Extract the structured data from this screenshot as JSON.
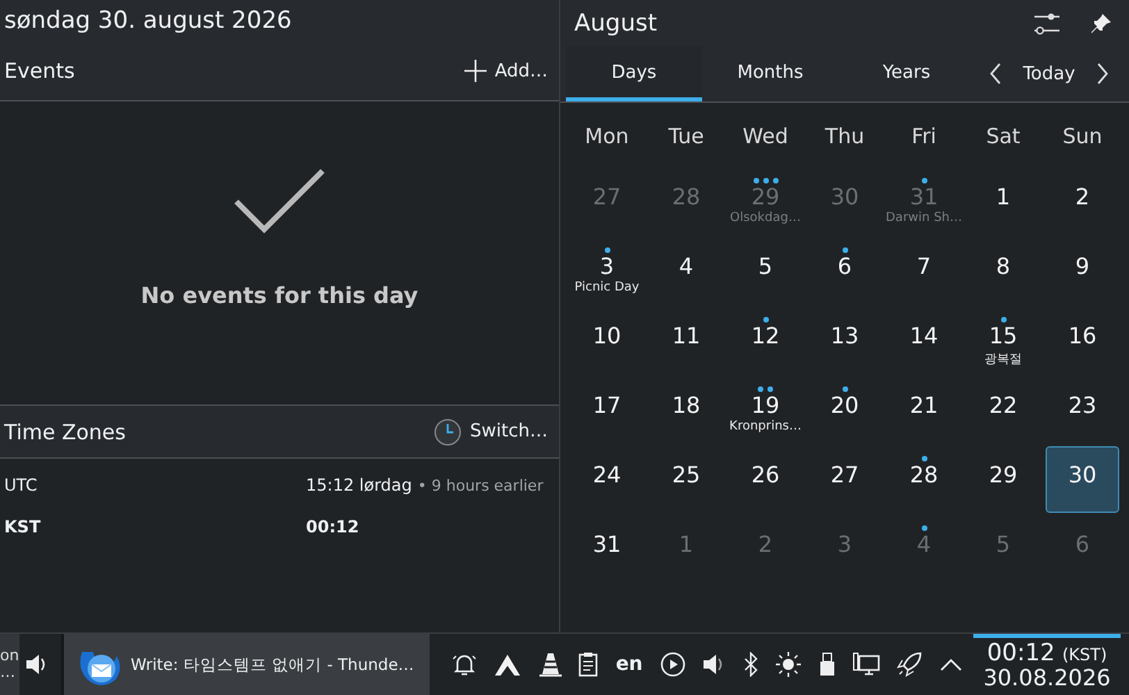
{
  "header": {
    "date": "søndag 30. august 2026"
  },
  "events": {
    "title": "Events",
    "add_label": "Add…",
    "empty_message": "No events for this day"
  },
  "time_zones": {
    "title": "Time Zones",
    "switch_label": "Switch…",
    "rows": [
      {
        "zone": "UTC",
        "time": "15:12 lørdag",
        "note": "• 9 hours earlier",
        "current": false
      },
      {
        "zone": "KST",
        "time": "00:12",
        "current": true
      }
    ]
  },
  "calendar": {
    "month": "August",
    "tabs": [
      {
        "label": "Days",
        "selected": true
      },
      {
        "label": "Months",
        "selected": false
      },
      {
        "label": "Years",
        "selected": false
      }
    ],
    "today_label": "Today",
    "weekdays": [
      "Mon",
      "Tue",
      "Wed",
      "Thu",
      "Fri",
      "Sat",
      "Sun"
    ],
    "days": [
      {
        "day": "27",
        "outside": true,
        "selected": false
      },
      {
        "day": "28",
        "outside": true,
        "selected": false
      },
      {
        "day": "29",
        "outside": true,
        "event_dots": [
          {
            "kind": "event"
          },
          {
            "kind": "event"
          },
          {
            "kind": "event"
          }
        ],
        "label": "Olsokdag…",
        "selected": false
      },
      {
        "day": "30",
        "outside": true,
        "selected": false
      },
      {
        "day": "31",
        "outside": true,
        "event_dots": [
          {
            "kind": "event"
          }
        ],
        "label": "Darwin Sh…",
        "selected": false
      },
      {
        "day": "1",
        "outside": false,
        "selected": false
      },
      {
        "day": "2",
        "outside": false,
        "selected": false
      },
      {
        "day": "3",
        "outside": false,
        "event_dots": [
          {
            "kind": "event"
          }
        ],
        "label": "Picnic Day",
        "selected": false
      },
      {
        "day": "4",
        "outside": false,
        "selected": false
      },
      {
        "day": "5",
        "outside": false,
        "selected": false
      },
      {
        "day": "6",
        "outside": false,
        "event_dots": [
          {
            "kind": "event"
          }
        ],
        "selected": false
      },
      {
        "day": "7",
        "outside": false,
        "selected": false
      },
      {
        "day": "8",
        "outside": false,
        "selected": false
      },
      {
        "day": "9",
        "outside": false,
        "selected": false
      },
      {
        "day": "10",
        "outside": false,
        "selected": false
      },
      {
        "day": "11",
        "outside": false,
        "selected": false
      },
      {
        "day": "12",
        "outside": false,
        "event_dots": [
          {
            "kind": "event"
          }
        ],
        "selected": false
      },
      {
        "day": "13",
        "outside": false,
        "selected": false
      },
      {
        "day": "14",
        "outside": false,
        "selected": false
      },
      {
        "day": "15",
        "outside": false,
        "event_dots": [
          {
            "kind": "event"
          }
        ],
        "label": "광복절",
        "selected": false
      },
      {
        "day": "16",
        "outside": false,
        "selected": false
      },
      {
        "day": "17",
        "outside": false,
        "selected": false
      },
      {
        "day": "18",
        "outside": false,
        "selected": false
      },
      {
        "day": "19",
        "outside": false,
        "event_dots": [
          {
            "kind": "event"
          },
          {
            "kind": "event"
          }
        ],
        "label": "Kronprins…",
        "selected": false
      },
      {
        "day": "20",
        "outside": false,
        "event_dots": [
          {
            "kind": "event"
          }
        ],
        "selected": false
      },
      {
        "day": "21",
        "outside": false,
        "selected": false
      },
      {
        "day": "22",
        "outside": false,
        "selected": false
      },
      {
        "day": "23",
        "outside": false,
        "selected": false
      },
      {
        "day": "24",
        "outside": false,
        "selected": false
      },
      {
        "day": "25",
        "outside": false,
        "selected": false
      },
      {
        "day": "26",
        "outside": false,
        "selected": false
      },
      {
        "day": "27",
        "outside": false,
        "selected": false
      },
      {
        "day": "28",
        "outside": false,
        "event_dots": [
          {
            "kind": "event"
          }
        ],
        "selected": false
      },
      {
        "day": "29",
        "outside": false,
        "selected": false
      },
      {
        "day": "30",
        "outside": false,
        "selected": true
      },
      {
        "day": "31",
        "outside": false,
        "selected": false
      },
      {
        "day": "1",
        "outside": true,
        "selected": false
      },
      {
        "day": "2",
        "outside": true,
        "selected": false
      },
      {
        "day": "3",
        "outside": true,
        "selected": false
      },
      {
        "day": "4",
        "outside": true,
        "event_dots": [
          {
            "kind": "event"
          }
        ],
        "selected": false
      },
      {
        "day": "5",
        "outside": true,
        "selected": false
      },
      {
        "day": "6",
        "outside": true,
        "selected": false
      }
    ]
  },
  "taskbar": {
    "previous_task": {
      "line1": "on",
      "line2": "…"
    },
    "task": {
      "title": "Write: 타임스템프 없애기 - Thunde…"
    },
    "keyboard_layout": "en",
    "clock": {
      "time": "00:12",
      "zone": "(KST)",
      "date": "30.08.2026"
    }
  }
}
